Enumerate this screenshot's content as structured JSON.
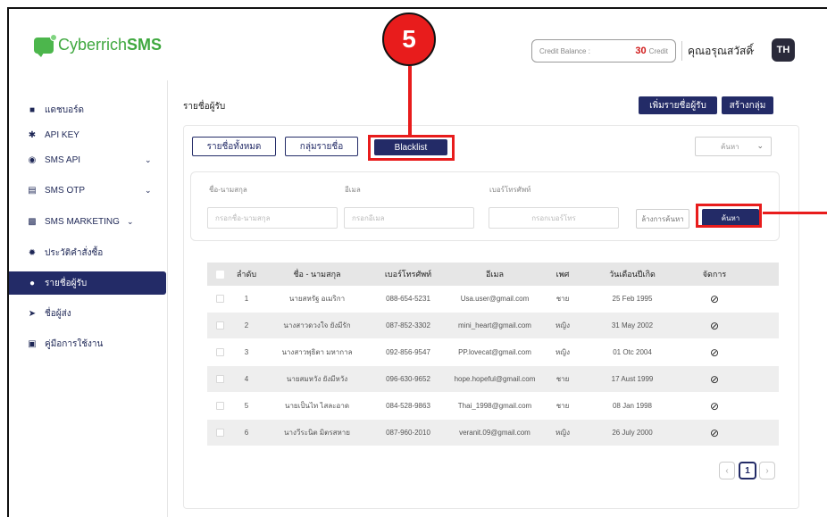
{
  "header": {
    "logo_prefix": "Cyberrich",
    "logo_suffix": "SMS",
    "credit_label": "Credit Balance :",
    "credit_value": "30",
    "credit_unit": "Credit",
    "user_name": "คุณอรุณสวัสดิ์",
    "avatar": "TH",
    "brand_color": "#3fa83f",
    "accent_color": "#232b67",
    "highlight_color": "#e81c1c"
  },
  "callout": {
    "number": "5"
  },
  "sidebar": {
    "items": [
      {
        "label": "แดชบอร์ด",
        "icon": "dashboard-icon"
      },
      {
        "label": "API KEY",
        "icon": "key-icon"
      },
      {
        "label": "SMS API",
        "icon": "globe-icon"
      },
      {
        "label": "SMS OTP",
        "icon": "otp-icon"
      },
      {
        "label": "SMS MARKETING",
        "icon": "marketing-icon"
      },
      {
        "label": "ประวัติคำสั่งซื้อ",
        "icon": "history-icon"
      },
      {
        "label": "รายชื่อผู้รับ",
        "icon": "contacts-icon"
      },
      {
        "label": "ชื่อผู้ส่ง",
        "icon": "send-icon"
      },
      {
        "label": "คู่มือการใช้งาน",
        "icon": "manual-icon"
      }
    ]
  },
  "main": {
    "title": "รายชื่อผู้รับ",
    "add_recipient_button": "เพิ่มรายชื่อผู้รับ",
    "create_group_button": "สร้างกลุ่ม",
    "tabs": [
      {
        "label": "รายชื่อทั้งหมด"
      },
      {
        "label": "กลุ่มรายชื่อ"
      },
      {
        "label": "Blacklist"
      }
    ],
    "search_select": "ค้นหา",
    "filters": {
      "name_label": "ชื่อ-นามสกุล",
      "name_placeholder": "กรอกชื่อ-นามสกุล",
      "email_label": "อีเมล",
      "email_placeholder": "กรอกอีเมล",
      "phone_label": "เบอร์โทรศัพท์",
      "phone_placeholder": "กรอกเบอร์โทร",
      "clear_button": "ล้างการค้นหา",
      "search_button": "ค้นหา"
    },
    "table": {
      "columns": [
        "ลำดับ",
        "ชื่อ - นามสกุล",
        "เบอร์โทรศัพท์",
        "อีเมล",
        "เพศ",
        "วันเดือนปีเกิด",
        "จัดการ"
      ],
      "rows": [
        [
          "1",
          "นายสหรัฐ อเมริกา",
          "088-654-5231",
          "Usa.user@gmail.com",
          "ชาย",
          "25 Feb 1995"
        ],
        [
          "2",
          "นางสาวดวงใจ ยังมีรัก",
          "087-852-3302",
          "mini_heart@gmail.com",
          "หญิง",
          "31 May 2002"
        ],
        [
          "3",
          "นางสาวพุธิตา มหากาล",
          "092-856-9547",
          "PP.lovecat@gmail.com",
          "หญิง",
          "01 Otc 2004"
        ],
        [
          "4",
          "นายสมหวัง ยังมีหวัง",
          "096-630-9652",
          "hope.hopeful@gmail.com",
          "ชาย",
          "17 Aust 1999"
        ],
        [
          "5",
          "นายเป็นไท ไสละอาด",
          "084-528-9863",
          "Thai_1998@gmail.com",
          "ชาย",
          "08 Jan 1998"
        ],
        [
          "6",
          "นางวีระนิต มิตรสหาย",
          "087-960-2010",
          "veranit.09@gmail.com",
          "หญิง",
          "26 July 2000"
        ]
      ]
    },
    "pagination": {
      "current": "1",
      "prev": "‹",
      "next": "›"
    }
  }
}
